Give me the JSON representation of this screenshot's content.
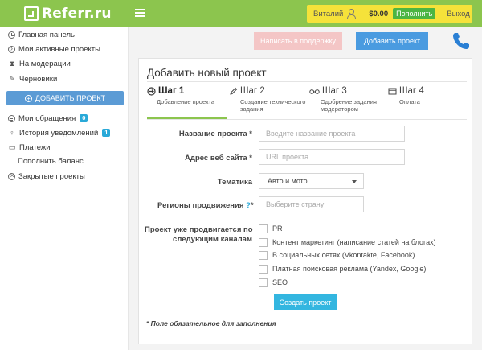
{
  "header": {
    "logo_text": "Referr.ru",
    "user_name": "Виталий",
    "balance": "$0.00",
    "pay_label": "Пополнить",
    "logout_label": "Выход",
    "bar_color": "#8cc54e"
  },
  "sidebar": {
    "items": [
      {
        "label": "Главная панель",
        "icon": "clock-icon"
      },
      {
        "label": "Мои активные проекты",
        "icon": "arrow-circle-icon"
      },
      {
        "label": "На модерации",
        "icon": "hourglass-icon"
      },
      {
        "label": "Черновики",
        "icon": "pencil-icon"
      }
    ],
    "add_project_label": "ДОБАВИТЬ ПРОЕКТ",
    "items2": [
      {
        "label": "Мои обращения",
        "icon": "chat-circle-icon",
        "badge": "0"
      },
      {
        "label": "История уведомлений",
        "icon": "bulb-icon",
        "badge": "1"
      },
      {
        "label": "Платежи",
        "icon": "card-icon"
      },
      {
        "label": "Пополнить баланс"
      },
      {
        "label": "Закрытые проекты",
        "icon": "x-circle-icon"
      }
    ]
  },
  "toolbar": {
    "support_label": "Написать в поддержку",
    "add_project_label": "Добавить проект",
    "phone_icon": "phone-icon"
  },
  "form": {
    "title": "Добавить новый проект",
    "steps": [
      {
        "title": "Шаг 1",
        "subtitle": "Добавление проекта",
        "icon": "arrow-circle-icon",
        "active": true
      },
      {
        "title": "Шаг 2",
        "subtitle": "Создание технического задания",
        "icon": "pencil-icon"
      },
      {
        "title": "Шаг 3",
        "subtitle": "Одобрение задания модератором",
        "icon": "glasses-icon"
      },
      {
        "title": "Шаг 4",
        "subtitle": "Оплата",
        "icon": "card-icon"
      }
    ],
    "fields": {
      "name_label": "Название проекта *",
      "name_placeholder": "Введите название проекта",
      "url_label": "Адрес веб сайта *",
      "url_placeholder": "URL проекта",
      "topic_label": "Тематика",
      "topic_value": "Авто и мото",
      "regions_label": "Регионы продвижения",
      "regions_star": "*",
      "regions_placeholder": "Выберите страну",
      "channels_label_1": "Проект уже продвигается по",
      "channels_label_2": "следующим каналам"
    },
    "channels": [
      "PR",
      "Контент маркетинг (написание статей на блогах)",
      "В социальных сетях (Vkontakte, Facebook)",
      "Платная поисковая реклама (Yandex, Google)",
      "SEO"
    ],
    "submit_label": "Создать проект",
    "footnote": "* Поле обязательное для заполнения"
  }
}
